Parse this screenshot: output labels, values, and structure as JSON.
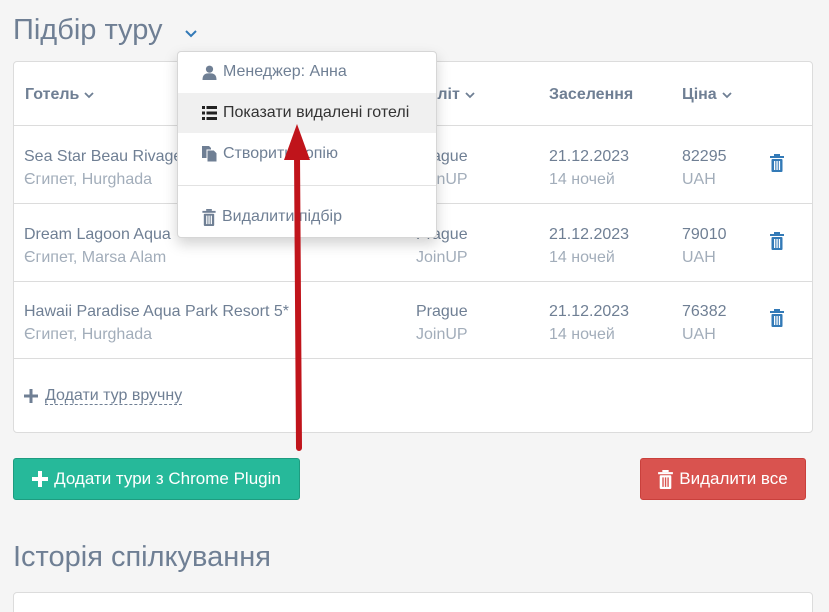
{
  "header": {
    "title": "Підбір туру"
  },
  "table": {
    "columns": {
      "hotel": "Готель",
      "departure": "Виліт",
      "checkin": "Заселення",
      "price": "Ціна"
    },
    "rows": [
      {
        "hotel": "Sea Star Beau Rivage",
        "location": "Єгипет, Hurghada",
        "city": "Prague",
        "operator": "JoinUP",
        "date": "21.12.2023",
        "nights": "14 ночей",
        "price": "82295",
        "currency": "UAH"
      },
      {
        "hotel": "Dream Lagoon Aqua",
        "location": "Єгипет, Marsa Alam",
        "city": "Prague",
        "operator": "JoinUP",
        "date": "21.12.2023",
        "nights": "14 ночей",
        "price": "79010",
        "currency": "UAH"
      },
      {
        "hotel": "Hawaii Paradise Aqua Park Resort 5*",
        "location": "Єгипет, Hurghada",
        "city": "Prague",
        "operator": "JoinUP",
        "date": "21.12.2023",
        "nights": "14 ночей",
        "price": "76382",
        "currency": "UAH"
      }
    ],
    "add_manual": "Додати тур вручну"
  },
  "buttons": {
    "add_chrome": "Додати тури з Chrome Plugin",
    "delete_all": "Видалити все"
  },
  "history": {
    "title": "Історія спілкування"
  },
  "dropdown": {
    "items": [
      {
        "label": "Менеджер: Анна",
        "icon": "user-icon"
      },
      {
        "label": "Показати видалені готелі",
        "icon": "list-icon"
      },
      {
        "label": "Створити копію",
        "icon": "copy-icon"
      },
      {
        "label": "Видалити підбір",
        "icon": "trash-icon"
      }
    ]
  },
  "colors": {
    "text": "#6f7f94",
    "muted": "#a2adba",
    "accent": "#337ab7",
    "green": "#26b99a",
    "red": "#d9534f",
    "arrow": "#c0141b"
  }
}
